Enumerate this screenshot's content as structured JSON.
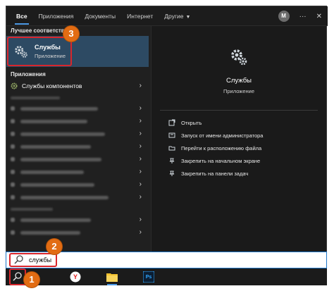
{
  "tabs": {
    "items": [
      {
        "label": "Все"
      },
      {
        "label": "Приложения"
      },
      {
        "label": "Документы"
      },
      {
        "label": "Интернет"
      },
      {
        "label": "Другие"
      }
    ],
    "avatar_letter": "M",
    "more_glyph": "···",
    "close_glyph": "✕"
  },
  "left": {
    "best_match_title": "Лучшее соответствие",
    "best_match": {
      "title": "Службы",
      "subtitle": "Приложение",
      "icon": "gear-icon"
    },
    "apps_title": "Приложения",
    "apps": [
      {
        "label": "Службы компонентов",
        "icon": "gear-icon"
      }
    ]
  },
  "detail": {
    "title": "Службы",
    "subtitle": "Приложение",
    "actions": [
      {
        "label": "Открыть",
        "icon": "open-icon"
      },
      {
        "label": "Запуск от имени администратора",
        "icon": "admin-icon"
      },
      {
        "label": "Перейти к расположению файла",
        "icon": "folder-icon"
      },
      {
        "label": "Закрепить на начальном экране",
        "icon": "pin-icon"
      },
      {
        "label": "Закрепить на панели задач",
        "icon": "pin-icon"
      }
    ]
  },
  "search": {
    "value": "службы",
    "icon": "search-icon"
  },
  "taskbar": {
    "icons": [
      "search-icon",
      "yandex-browser-icon",
      "file-explorer-icon",
      "photoshop-icon"
    ],
    "ps_label": "Ps",
    "yandex_label": "Y"
  },
  "badges": {
    "one": "1",
    "two": "2",
    "three": "3"
  },
  "colors": {
    "accent": "#4c9ae6",
    "badge": "#e26c13",
    "highlight": "#d9262c"
  }
}
